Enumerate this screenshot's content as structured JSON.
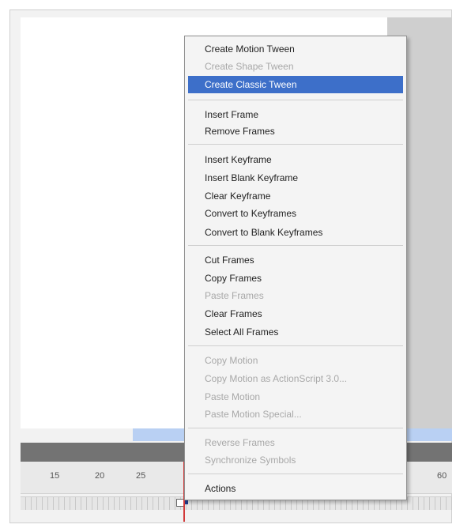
{
  "timeline": {
    "ruler_numbers": [
      "15",
      "20",
      "25",
      "60"
    ]
  },
  "menu": {
    "items": [
      {
        "label": "Create Motion Tween",
        "enabled": true
      },
      {
        "label": "Create Shape Tween",
        "enabled": false
      },
      {
        "label": "Create Classic Tween",
        "enabled": true,
        "selected": true
      },
      {
        "label": "Insert Frame",
        "enabled": true
      },
      {
        "label": "Remove Frames",
        "enabled": true
      },
      {
        "label": "Insert Keyframe",
        "enabled": true
      },
      {
        "label": "Insert Blank Keyframe",
        "enabled": true
      },
      {
        "label": "Clear Keyframe",
        "enabled": true
      },
      {
        "label": "Convert to Keyframes",
        "enabled": true
      },
      {
        "label": "Convert to Blank Keyframes",
        "enabled": true
      },
      {
        "label": "Cut Frames",
        "enabled": true
      },
      {
        "label": "Copy Frames",
        "enabled": true
      },
      {
        "label": "Paste Frames",
        "enabled": false
      },
      {
        "label": "Clear Frames",
        "enabled": true
      },
      {
        "label": "Select All Frames",
        "enabled": true
      },
      {
        "label": "Copy Motion",
        "enabled": false
      },
      {
        "label": "Copy Motion as ActionScript 3.0...",
        "enabled": false
      },
      {
        "label": "Paste Motion",
        "enabled": false
      },
      {
        "label": "Paste Motion Special...",
        "enabled": false
      },
      {
        "label": "Reverse Frames",
        "enabled": false
      },
      {
        "label": "Synchronize Symbols",
        "enabled": false
      },
      {
        "label": "Actions",
        "enabled": true
      }
    ]
  },
  "colors": {
    "selection": "#3d6fc9",
    "playhead": "#d23a3a",
    "disabled_text": "#a8a8a8"
  }
}
